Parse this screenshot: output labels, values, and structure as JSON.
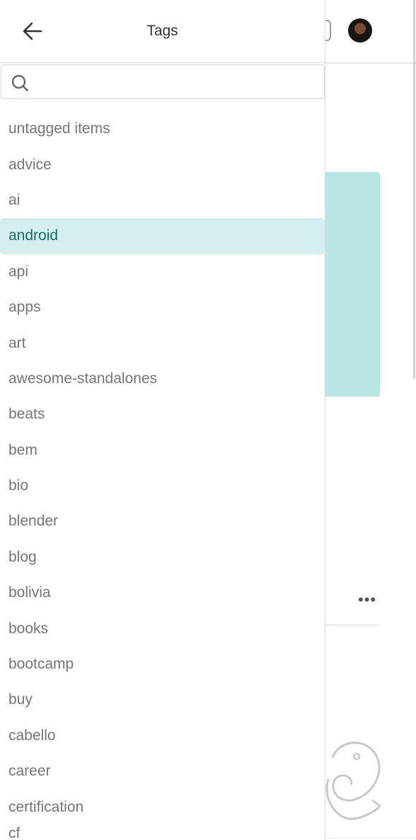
{
  "drawer": {
    "title": "Tags",
    "back_icon": "arrow-left-icon",
    "search": {
      "placeholder": "",
      "value": "",
      "icon": "search-icon"
    }
  },
  "tags": [
    "untagged items",
    "advice",
    "ai",
    "android",
    "api",
    "apps",
    "art",
    "awesome-standalones",
    "beats",
    "bem",
    "bio",
    "blender",
    "blog",
    "bolivia",
    "books",
    "bootcamp",
    "buy",
    "cabello",
    "career",
    "certification"
  ],
  "selected_tag": "android",
  "partial_tag": "cf",
  "background": {
    "more_label": "•••",
    "card_color": "#b8e6e3"
  },
  "colors": {
    "active_bg": "#d4efed",
    "active_text": "#1a6b66",
    "item_text": "#757575"
  }
}
